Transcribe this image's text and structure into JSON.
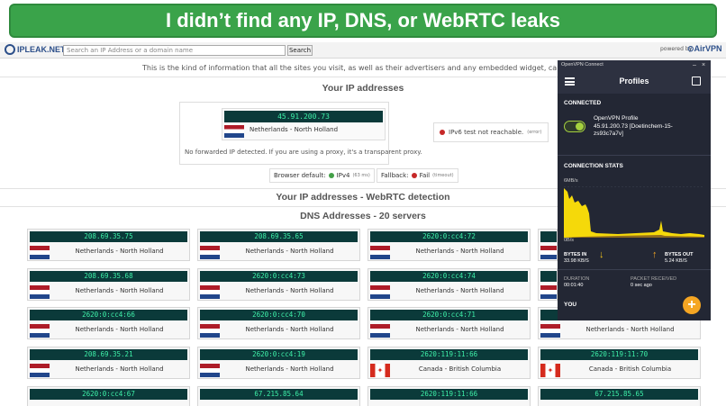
{
  "banner": {
    "text": "I didn’t find any IP, DNS, or WebRTC leaks"
  },
  "topbar": {
    "logo": "IPLEAK.NET",
    "search_placeholder": "Search an IP Address or a domain name",
    "search_button": "Search",
    "powered_by": "powered by",
    "brand": "AirVPN"
  },
  "intro": "This is the kind of information that all the sites you visit, as well as their advertisers and any embedded widget, can see and collect ab",
  "ip_section": {
    "title": "Your IP addresses",
    "ip": "45.91.200.73",
    "location": "Netherlands - North Holland",
    "no_proxy": "No forwarded IP detected. If you are using a proxy, it's a transparent proxy.",
    "ipv6": "IPv6 test not reachable.",
    "ipv6_tag": "(error)",
    "browser_default_label": "Browser default:",
    "browser_default_value": "IPv4",
    "browser_default_ms": "(63 ms)",
    "fallback_label": "Fallback:",
    "fallback_value": "Fail",
    "fallback_tag": "(timeout)"
  },
  "webrtc_title": "Your IP addresses - WebRTC detection",
  "dns": {
    "title": "DNS Addresses - 20 servers",
    "rows": [
      [
        {
          "ip": "208.69.35.75",
          "loc": "Netherlands - North Holland",
          "flag": "nl"
        },
        {
          "ip": "208.69.35.65",
          "loc": "Netherlands - North Holland",
          "flag": "nl"
        },
        {
          "ip": "2620:0:cc4:72",
          "loc": "Netherlands - North Holland",
          "flag": "nl"
        }
      ],
      [
        {
          "ip": "208.69.35.68",
          "loc": "Netherlands - North Holland",
          "flag": "nl"
        },
        {
          "ip": "2620:0:cc4:73",
          "loc": "Netherlands - North Holland",
          "flag": "nl"
        },
        {
          "ip": "2620:0:cc4:74",
          "loc": "Netherlands - North Holland",
          "flag": "nl"
        }
      ],
      [
        {
          "ip": "2620:0:cc4:66",
          "loc": "Netherlands - North Holland",
          "flag": "nl"
        },
        {
          "ip": "2620:0:cc4:70",
          "loc": "Netherlands - North Holland",
          "flag": "nl"
        },
        {
          "ip": "2620:0:cc4:71",
          "loc": "Netherlands - North Holland",
          "flag": "nl"
        }
      ],
      [
        {
          "ip": "208.69.35.21",
          "loc": "Netherlands - North Holland",
          "flag": "nl"
        },
        {
          "ip": "2620:0:cc4:19",
          "loc": "Netherlands - North Holland",
          "flag": "nl"
        },
        {
          "ip": "2620:119:11:66",
          "loc": "Canada - British Columbia",
          "flag": "ca"
        },
        {
          "ip": "2620:119:11:70",
          "loc": "Canada - British Columbia",
          "flag": "ca"
        }
      ],
      [
        {
          "ip": "2620:0:cc4:67",
          "loc": "",
          "flag": ""
        },
        {
          "ip": "67.215.85.64",
          "loc": "",
          "flag": ""
        },
        {
          "ip": "2620:119:11:66",
          "loc": "",
          "flag": ""
        },
        {
          "ip": "67.215.85.65",
          "loc": "",
          "flag": ""
        }
      ]
    ],
    "extra_col4_locs": [
      "",
      "Netherlands - North Holland",
      "Netherlands - North Holland"
    ]
  },
  "vpn": {
    "window_title": "OpenVPN Connect",
    "min": "–",
    "close": "×",
    "header": "Profiles",
    "connected": "CONNECTED",
    "profile_label": "OpenVPN Profile",
    "profile_name": "45.91.200.73 [Doetinchem-15-zs93c7a7v]",
    "stats_title": "CONNECTION STATS",
    "chart_top": "6MB/s",
    "chart_bottom": "0B/s",
    "bytes_in_label": "BYTES IN",
    "bytes_in": "33.98 KB/S",
    "bytes_out_label": "BYTES OUT",
    "bytes_out": "5.24 KB/S",
    "duration_label": "DURATION",
    "duration": "00:01:40",
    "packet_label": "PACKET RECEIVED",
    "packet": "0 sec ago",
    "you": "YOU",
    "fab": "+",
    "accent": "#f5a623",
    "chart_color": "#f5d90a"
  }
}
